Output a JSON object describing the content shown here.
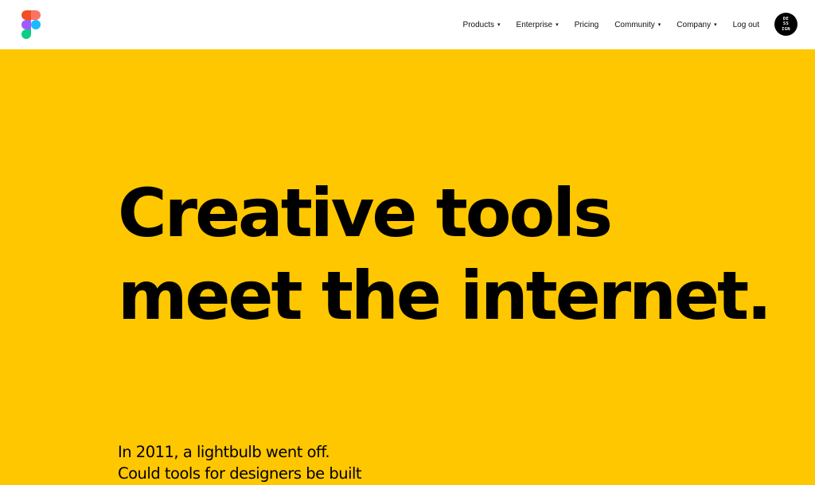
{
  "nav": {
    "items": [
      {
        "label": "Products",
        "has_dropdown": true
      },
      {
        "label": "Enterprise",
        "has_dropdown": true
      },
      {
        "label": "Pricing",
        "has_dropdown": false
      },
      {
        "label": "Community",
        "has_dropdown": true
      },
      {
        "label": "Company",
        "has_dropdown": true
      },
      {
        "label": "Log out",
        "has_dropdown": false
      }
    ],
    "caret": "▾",
    "avatar_lines": [
      "DE",
      "SS",
      "IGN"
    ]
  },
  "hero": {
    "title_lines": [
      "Creative tools",
      "meet the internet."
    ]
  },
  "intro": {
    "lines": [
      "In 2011, a lightbulb went off.",
      "Could tools for designers be built"
    ]
  },
  "colors": {
    "background": "#ffc700",
    "navbar": "#ffffff",
    "text": "#000000",
    "logo_red": "#f24e1e",
    "logo_orange": "#ff7262",
    "logo_purple": "#a259ff",
    "logo_blue": "#1abcfe",
    "logo_green": "#0acf83"
  }
}
